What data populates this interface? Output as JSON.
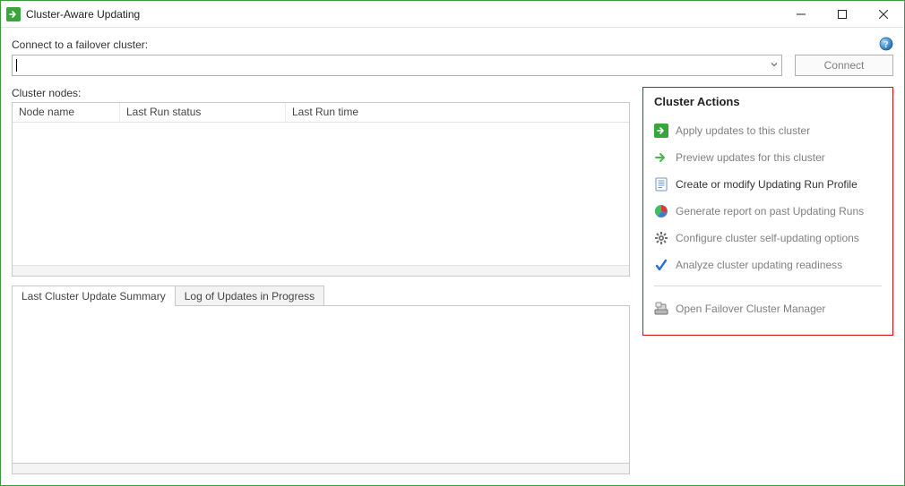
{
  "title": "Cluster-Aware Updating",
  "connect": {
    "label": "Connect to a failover cluster:",
    "value": "",
    "button": "Connect"
  },
  "nodes": {
    "label": "Cluster nodes:",
    "columns": [
      "Node name",
      "Last Run status",
      "Last Run time"
    ],
    "rows": []
  },
  "tabs": {
    "items": [
      "Last Cluster Update Summary",
      "Log of Updates in Progress"
    ],
    "active_index": 0
  },
  "actions": {
    "title": "Cluster Actions",
    "items": [
      {
        "icon": "apply-updates-icon",
        "label": "Apply updates to this cluster",
        "enabled": false
      },
      {
        "icon": "preview-updates-icon",
        "label": "Preview updates for this cluster",
        "enabled": false
      },
      {
        "icon": "profile-icon",
        "label": "Create or modify Updating Run Profile",
        "enabled": true
      },
      {
        "icon": "report-icon",
        "label": "Generate report on past Updating Runs",
        "enabled": false
      },
      {
        "icon": "configure-icon",
        "label": "Configure cluster self-updating options",
        "enabled": false
      },
      {
        "icon": "analyze-icon",
        "label": "Analyze cluster updating readiness",
        "enabled": false
      }
    ],
    "footer_item": {
      "icon": "failover-manager-icon",
      "label": "Open Failover Cluster Manager",
      "enabled": false
    }
  }
}
